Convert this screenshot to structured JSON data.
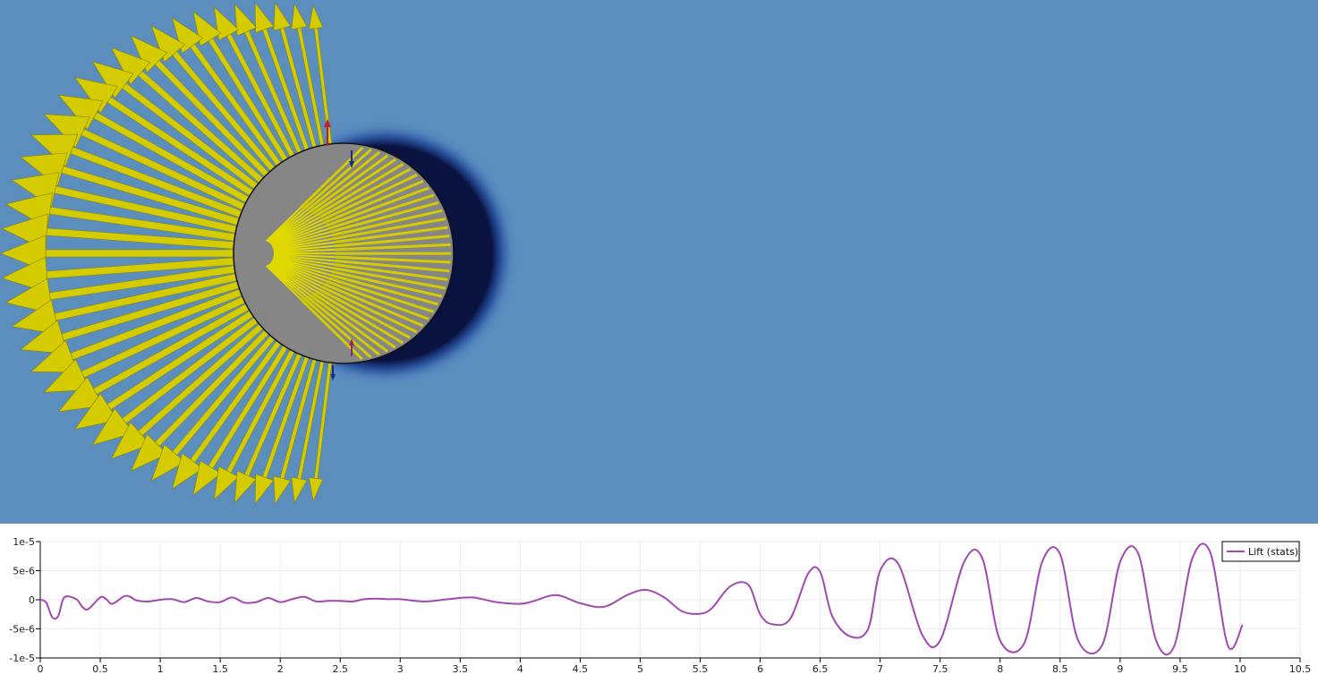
{
  "viewport": {
    "background": "#5b8dbd",
    "cylinder_color": "#868686",
    "arrow_color": "#d4cc00",
    "wake_color": "#0a1a5c"
  },
  "chart_data": {
    "type": "line",
    "xlim": [
      0,
      10.5
    ],
    "ylim": [
      -1e-05,
      1e-05
    ],
    "x_ticks": [
      0,
      0.5,
      1,
      1.5,
      2,
      2.5,
      3,
      3.5,
      4,
      4.5,
      5,
      5.5,
      6,
      6.5,
      7,
      7.5,
      8,
      8.5,
      9,
      9.5,
      10,
      10.5
    ],
    "x_tick_labels": [
      "0",
      "0.5",
      "1",
      "1.5",
      "2",
      "2.5",
      "3",
      "3.5",
      "4",
      "4.5",
      "5",
      "5.5",
      "6",
      "6.5",
      "7",
      "7.5",
      "8",
      "8.5",
      "9",
      "9.5",
      "10",
      "10.5"
    ],
    "y_ticks": [
      1e-05,
      5e-06,
      0,
      -5e-06,
      -1e-05
    ],
    "y_tick_labels": [
      "1e-5",
      "5e-6",
      "0",
      "-5e-6",
      "-1e-5"
    ],
    "grid": true,
    "legend_position": "top-right",
    "series": [
      {
        "name": "Lift (stats)",
        "color": "#a04bb0",
        "x": [
          0,
          0.05,
          0.1,
          0.15,
          0.2,
          0.3,
          0.35,
          0.4,
          0.5,
          0.55,
          0.6,
          0.7,
          0.75,
          0.8,
          0.9,
          1.0,
          1.1,
          1.2,
          1.3,
          1.4,
          1.5,
          1.6,
          1.7,
          1.8,
          1.9,
          2.0,
          2.1,
          2.2,
          2.3,
          2.4,
          2.5,
          2.6,
          2.7,
          2.8,
          2.9,
          3.0,
          3.2,
          3.4,
          3.6,
          3.8,
          4.0,
          4.1,
          4.3,
          4.5,
          4.7,
          4.9,
          5.05,
          5.2,
          5.35,
          5.5,
          5.6,
          5.75,
          5.9,
          6.0,
          6.1,
          6.25,
          6.4,
          6.5,
          6.6,
          6.75,
          6.9,
          7.0,
          7.15,
          7.35,
          7.5,
          7.7,
          7.85,
          8.0,
          8.2,
          8.35,
          8.5,
          8.65,
          8.85,
          9.0,
          9.15,
          9.3,
          9.45,
          9.6,
          9.75,
          9.9,
          10.02
        ],
        "y": [
          0,
          -5e-07,
          -3e-06,
          -2.8e-06,
          4e-07,
          1e-07,
          -1.2e-06,
          -1.6e-06,
          4e-07,
          1e-07,
          -7e-07,
          6e-07,
          5e-07,
          -1e-07,
          -3e-07,
          0,
          1e-07,
          -4e-07,
          3e-07,
          -3e-07,
          -4e-07,
          4e-07,
          -5e-07,
          -4e-07,
          3e-07,
          -4e-07,
          1e-07,
          5e-07,
          -3e-07,
          -2e-07,
          -2e-07,
          -3e-07,
          1e-07,
          2e-07,
          1e-07,
          1e-07,
          -3e-07,
          1e-07,
          4e-07,
          -4e-07,
          -7e-07,
          -3e-07,
          8e-07,
          -6e-07,
          -1.2e-06,
          9e-07,
          1.7e-06,
          4e-07,
          -2e-06,
          -2.4e-06,
          -1.4e-06,
          2.3e-06,
          2.6e-06,
          -2.5e-06,
          -4.2e-06,
          -3.3e-06,
          4.5e-06,
          4.8e-06,
          -2.8e-06,
          -6.3e-06,
          -5e-06,
          5e-06,
          6.2e-06,
          -6e-06,
          -7e-06,
          6.5e-06,
          7.2e-06,
          -7e-06,
          -7.5e-06,
          6.5e-06,
          7.8e-06,
          -7e-06,
          -7.8e-06,
          6.5e-06,
          8e-06,
          -7e-06,
          -8e-06,
          7e-06,
          8.2e-06,
          -8e-06,
          -4.3e-06
        ]
      }
    ]
  }
}
